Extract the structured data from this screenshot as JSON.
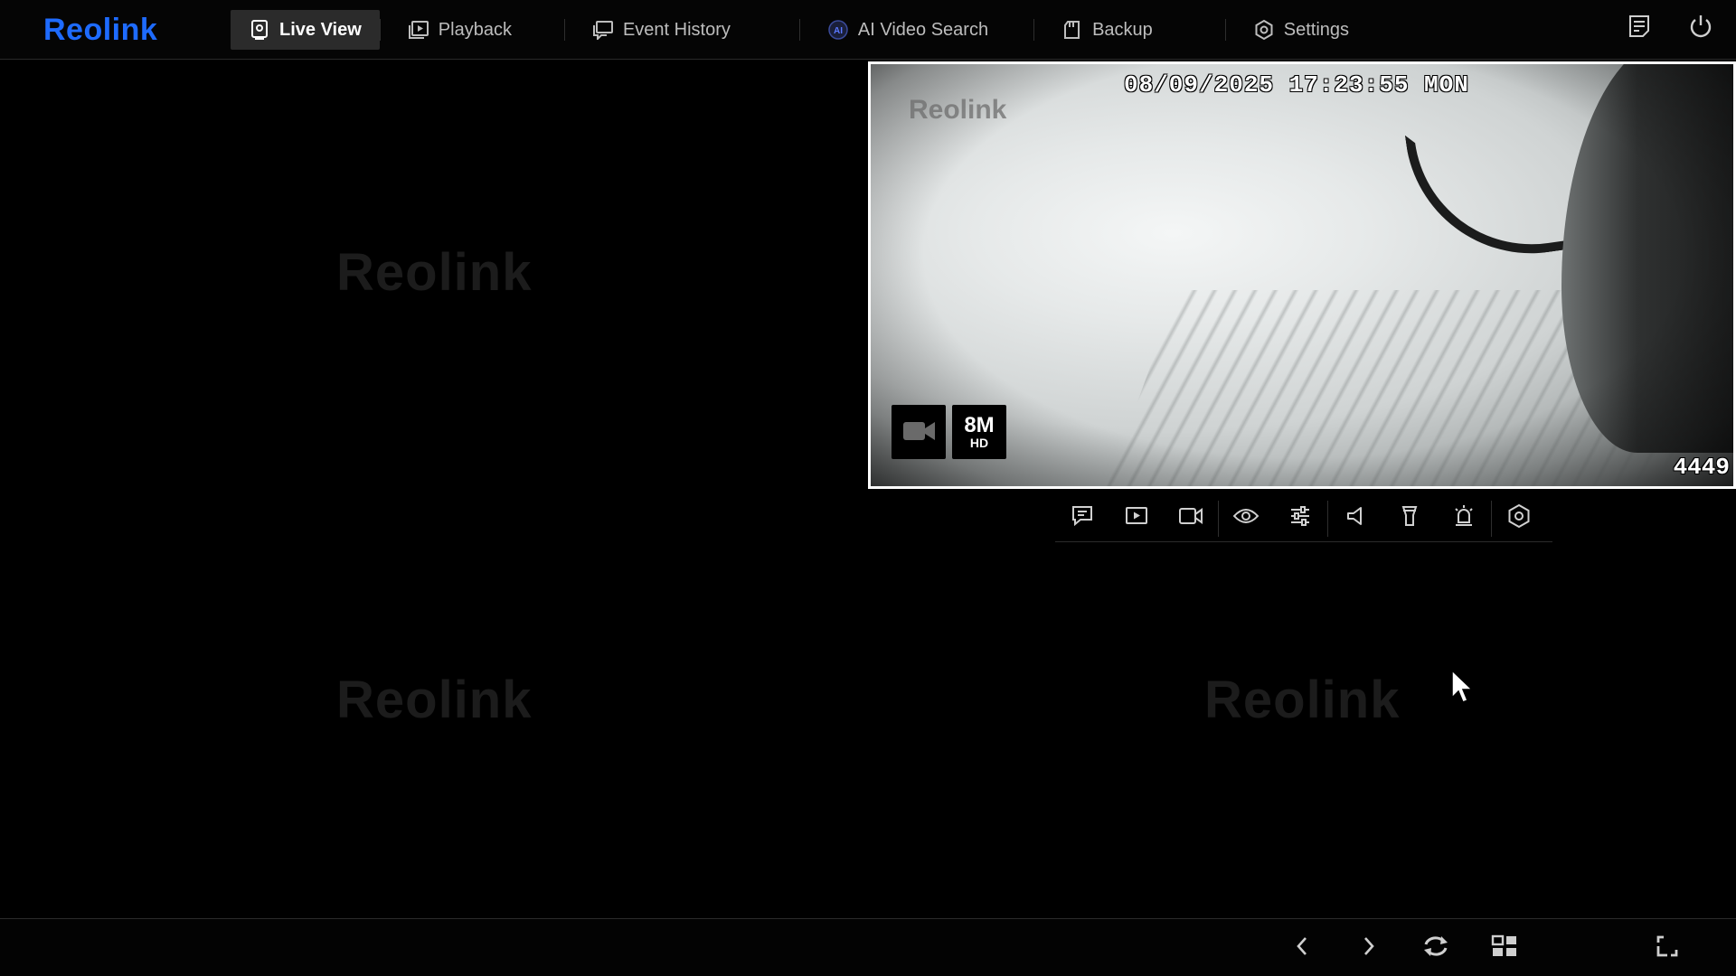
{
  "brand": {
    "name": "Reolink",
    "color": "#1e6bff"
  },
  "nav": {
    "tabs": [
      {
        "label": "Live View",
        "icon": "live-view-icon",
        "active": true
      },
      {
        "label": "Playback",
        "icon": "playback-icon",
        "active": false
      },
      {
        "label": "Event History",
        "icon": "event-history-icon",
        "active": false
      },
      {
        "label": "AI Video Search",
        "icon": "ai-search-icon",
        "active": false
      },
      {
        "label": "Backup",
        "icon": "backup-icon",
        "active": false
      },
      {
        "label": "Settings",
        "icon": "gear-icon",
        "active": false
      }
    ],
    "right_buttons": [
      {
        "icon": "log-icon"
      },
      {
        "icon": "power-icon"
      }
    ],
    "ai_badge": "AI"
  },
  "grid": {
    "empty_watermark": "Reolink"
  },
  "feed": {
    "timestamp": "08/09/2025 17:23:55 MON",
    "logo": "Reolink",
    "channel_id": "4449",
    "resolution_main": "8M",
    "resolution_sub": "HD"
  },
  "feed_toolbar": {
    "buttons": [
      "talk-icon",
      "play-icon",
      "record-icon",
      "eye-icon",
      "adjust-icon",
      "speaker-icon",
      "spotlight-icon",
      "siren-icon",
      "ptz-icon"
    ]
  },
  "bottom_bar": {
    "buttons": [
      "chevron-left-icon",
      "chevron-right-icon",
      "rotate-icon",
      "layout-grid-icon",
      "fullscreen-icon"
    ]
  }
}
